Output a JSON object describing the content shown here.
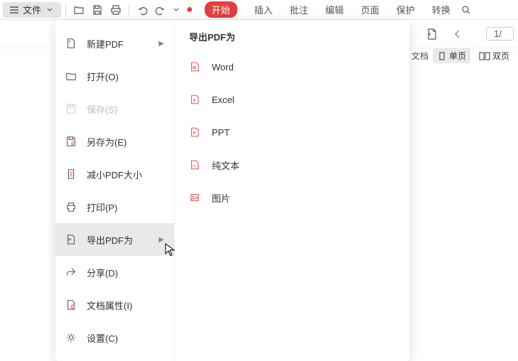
{
  "toolbar": {
    "file_label": "文件"
  },
  "tabs": {
    "start": "开始",
    "insert": "插入",
    "comment": "批注",
    "edit": "编辑",
    "page": "页面",
    "protect": "保护",
    "convert": "转换"
  },
  "page_info": {
    "indicator": "1/"
  },
  "view": {
    "doc_frag": "文档",
    "single": "单页",
    "double": "双页"
  },
  "menu": {
    "new_pdf": "新建PDF",
    "open": "打开(O)",
    "save": "保存(S)",
    "save_as": "另存为(E)",
    "reduce": "减小PDF大小",
    "print": "打印(P)",
    "export": "导出PDF为",
    "share": "分享(D)",
    "props": "文档属性(I)",
    "settings": "设置(C)"
  },
  "submenu": {
    "title": "导出PDF为",
    "word": "Word",
    "excel": "Excel",
    "ppt": "PPT",
    "text": "纯文本",
    "image": "图片"
  }
}
